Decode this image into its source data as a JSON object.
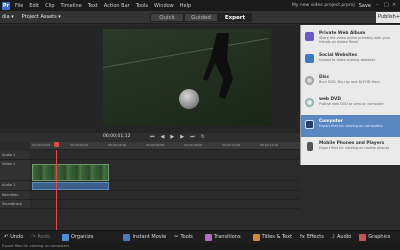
{
  "menubar": {
    "items": [
      "File",
      "Edit",
      "Clip",
      "Timeline",
      "Text",
      "Action Bar",
      "Tools",
      "Window",
      "Help"
    ],
    "project_title": "My new video project.prproj",
    "save_label": "Save"
  },
  "toolbar": {
    "media_label": "dia",
    "assets_label": "Project Assets",
    "tabs": [
      "Quick",
      "Guided",
      "Expert"
    ],
    "active_tab": "Expert",
    "publish_label": "Publish+"
  },
  "publish": {
    "items": [
      {
        "title": "Private Web Album",
        "desc": "Share the video online privately with your friends on Adobe Revel"
      },
      {
        "title": "Social Websites",
        "desc": "Upload to video sharing websites"
      },
      {
        "title": "Disc",
        "desc": "Burn DVD, Blu-ray and AVCHD discs"
      },
      {
        "title": "web DVD",
        "desc": "Publish web DVD to view on computer"
      },
      {
        "title": "Computer",
        "desc": "Export files for viewing on computers"
      },
      {
        "title": "Mobile Phones and Players",
        "desc": "Export files for viewing on mobile phones"
      }
    ],
    "active_index": 4
  },
  "transport": {
    "timecode": "00;00;01;12"
  },
  "timeline": {
    "tracks": [
      "Audio 1",
      "Video 1",
      "Audio 1",
      "Narration",
      "Soundtrack"
    ],
    "ruler_marks": [
      "00;00;00;00",
      "00;00;02;00",
      "00;00;04;00",
      "00;00;06;00",
      "00;00;08;00",
      "00;00;10;00",
      "00;00;12;00"
    ]
  },
  "bottombar": {
    "undo_label": "Undo",
    "redo_label": "Redo",
    "organizer_label": "Organize",
    "instant_movie_label": "Instant Movie",
    "tools_label": "Tools",
    "transitions_label": "Transitions",
    "titles_label": "Titles & Text",
    "effects_label": "Effects",
    "audio_label": "Audio",
    "graphics_label": "Graphics"
  },
  "status": {
    "text": "Export files for viewing on computers"
  },
  "colors": {
    "accent": "#5a86c2",
    "playhead": "#e8454d"
  }
}
